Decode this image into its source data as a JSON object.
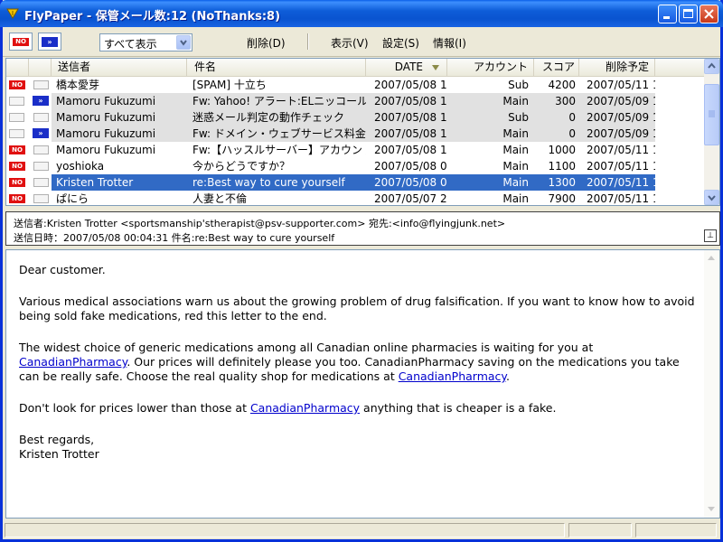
{
  "window": {
    "title": "FlyPaper - 保管メール数:12 (NoThanks:8)",
    "accent": "#0a54d0"
  },
  "toolbar": {
    "no_button_label": "NO",
    "forward_button_label": "»",
    "filter_select": "すべて表示",
    "menu": {
      "delete": "削除(D)",
      "view": "表示(V)",
      "settings": "設定(S)",
      "info": "情報(I)"
    }
  },
  "list": {
    "columns": {
      "sender": "送信者",
      "subject": "件名",
      "date": "DATE",
      "account": "アカウント",
      "score": "スコア",
      "delete_scheduled": "削除予定"
    },
    "sort_column": "date",
    "rows": [
      {
        "mark": "NO",
        "fwd": false,
        "sender": "橋本愛芽",
        "subject": "[SPAM] 十立ち",
        "date": "2007/05/08 1...",
        "account": "Sub",
        "score": "4200",
        "delete_date": "2007/05/11 1...",
        "style": "normal"
      },
      {
        "mark": "",
        "fwd": true,
        "sender": "Mamoru Fukuzumi",
        "subject": "Fw: Yahoo! アラート:ELニッコールー...",
        "date": "2007/05/08 1...",
        "account": "Main",
        "score": "300",
        "delete_date": "2007/05/09 1...",
        "style": "grey"
      },
      {
        "mark": "",
        "fwd": false,
        "sender": "Mamoru Fukuzumi",
        "subject": "迷惑メール判定の動作チェック",
        "date": "2007/05/08 1...",
        "account": "Sub",
        "score": "0",
        "delete_date": "2007/05/09 1...",
        "style": "grey"
      },
      {
        "mark": "",
        "fwd": true,
        "sender": "Mamoru Fukuzumi",
        "subject": "Fw: ドメイン・ウェブサービス料金の領...",
        "date": "2007/05/08 1...",
        "account": "Main",
        "score": "0",
        "delete_date": "2007/05/09 1...",
        "style": "grey"
      },
      {
        "mark": "NO",
        "fwd": false,
        "sender": "Mamoru Fukuzumi",
        "subject": "Fw:【ハッスルサーバー】アカウント停...",
        "date": "2007/05/08 1...",
        "account": "Main",
        "score": "1000",
        "delete_date": "2007/05/11 1...",
        "style": "normal"
      },
      {
        "mark": "NO",
        "fwd": false,
        "sender": "yoshioka",
        "subject": "今からどうですか？",
        "date": "2007/05/08 0...",
        "account": "Main",
        "score": "1100",
        "delete_date": "2007/05/11 1...",
        "style": "normal"
      },
      {
        "mark": "NO",
        "fwd": false,
        "sender": "Kristen Trotter",
        "subject": "re:Best way to cure yourself",
        "date": "2007/05/08 0...",
        "account": "Main",
        "score": "1300",
        "delete_date": "2007/05/11 1...",
        "style": "selected"
      },
      {
        "mark": "NO",
        "fwd": false,
        "sender": "ぱにら",
        "subject": "人妻と不倫",
        "date": "2007/05/07 2...",
        "account": "Main",
        "score": "7900",
        "delete_date": "2007/05/11 1...",
        "style": "normal"
      }
    ]
  },
  "header_pane": {
    "line1": "送信者:Kristen Trotter <sportsmanship'stherapist@psv-supporter.com>   宛先:<info@flyingjunk.net>",
    "line2": "送信日時：2007/05/08 00:04:31   件名:re:Best way to cure yourself",
    "toggle_glyph": "⊥"
  },
  "body": {
    "greeting": "Dear customer.",
    "p1": "Various medical associations warn us about the growing problem of drug falsification. If you want to know how to avoid being sold fake medications, red this letter to the end.",
    "p2_a": "The widest choice of generic medications among all Canadian online pharmacies is waiting for you at ",
    "link": "CanadianPharmacy",
    "p2_b": ". Our prices will definitely please you too. CanadianPharmacy saving on the medications you take can be really safe. Choose the real quality shop for medications at ",
    "p2_c": ".",
    "p3_a": "Don't look for prices lower than those at ",
    "p3_b": " anything that is cheaper is a fake.",
    "closing": "Best regards,",
    "signature": "Kristen Trotter"
  }
}
